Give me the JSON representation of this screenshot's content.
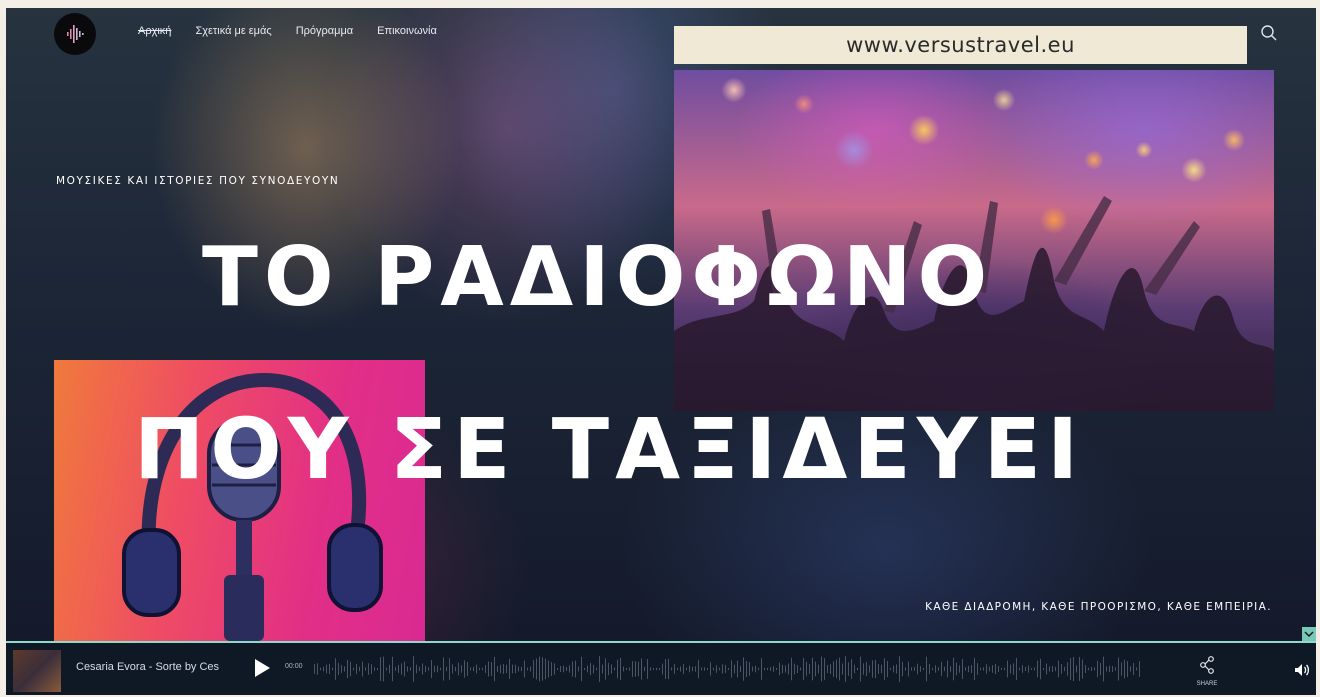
{
  "nav": {
    "items": [
      {
        "label": "Αρχική",
        "active": true
      },
      {
        "label": "Σχετικά με εμάς",
        "active": false
      },
      {
        "label": "Πρόγραμμα",
        "active": false
      },
      {
        "label": "Επικοινωνία",
        "active": false
      }
    ]
  },
  "header": {
    "url": "www.versustravel.eu",
    "search_icon": "search-icon",
    "logo_icon": "waveform-logo"
  },
  "hero": {
    "tagline": "ΜΟΥΣΙΚΕΣ ΚΑΙ ΙΣΤΟΡΙΕΣ ΠΟΥ ΣΥΝΟΔΕΥΟΥΝ",
    "title_line1": "ΤΟ ΡΑΔΙΟΦΩΝΟ",
    "title_line2": "ΠΟΥ ΣΕ ΤΑΞΙΔΕΥΕΙ",
    "subline": "ΚΑΘΕ ΔΙΑΔΡΟΜΗ, ΚΑΘΕ ΠΡΟΟΡΙΣΜΟ, ΚΑΘΕ ΕΜΠΕΙΡΙΑ."
  },
  "player": {
    "track": "Cesaria Evora - Sorte by Ces",
    "time": "00:00",
    "share_label": "SHARE",
    "play_icon": "play-icon",
    "share_icon": "share-icon",
    "volume_icon": "volume-icon"
  },
  "colors": {
    "accent": "#8ed9c9",
    "url_bar": "#efe9d6",
    "player_bg": "#0f1825"
  }
}
